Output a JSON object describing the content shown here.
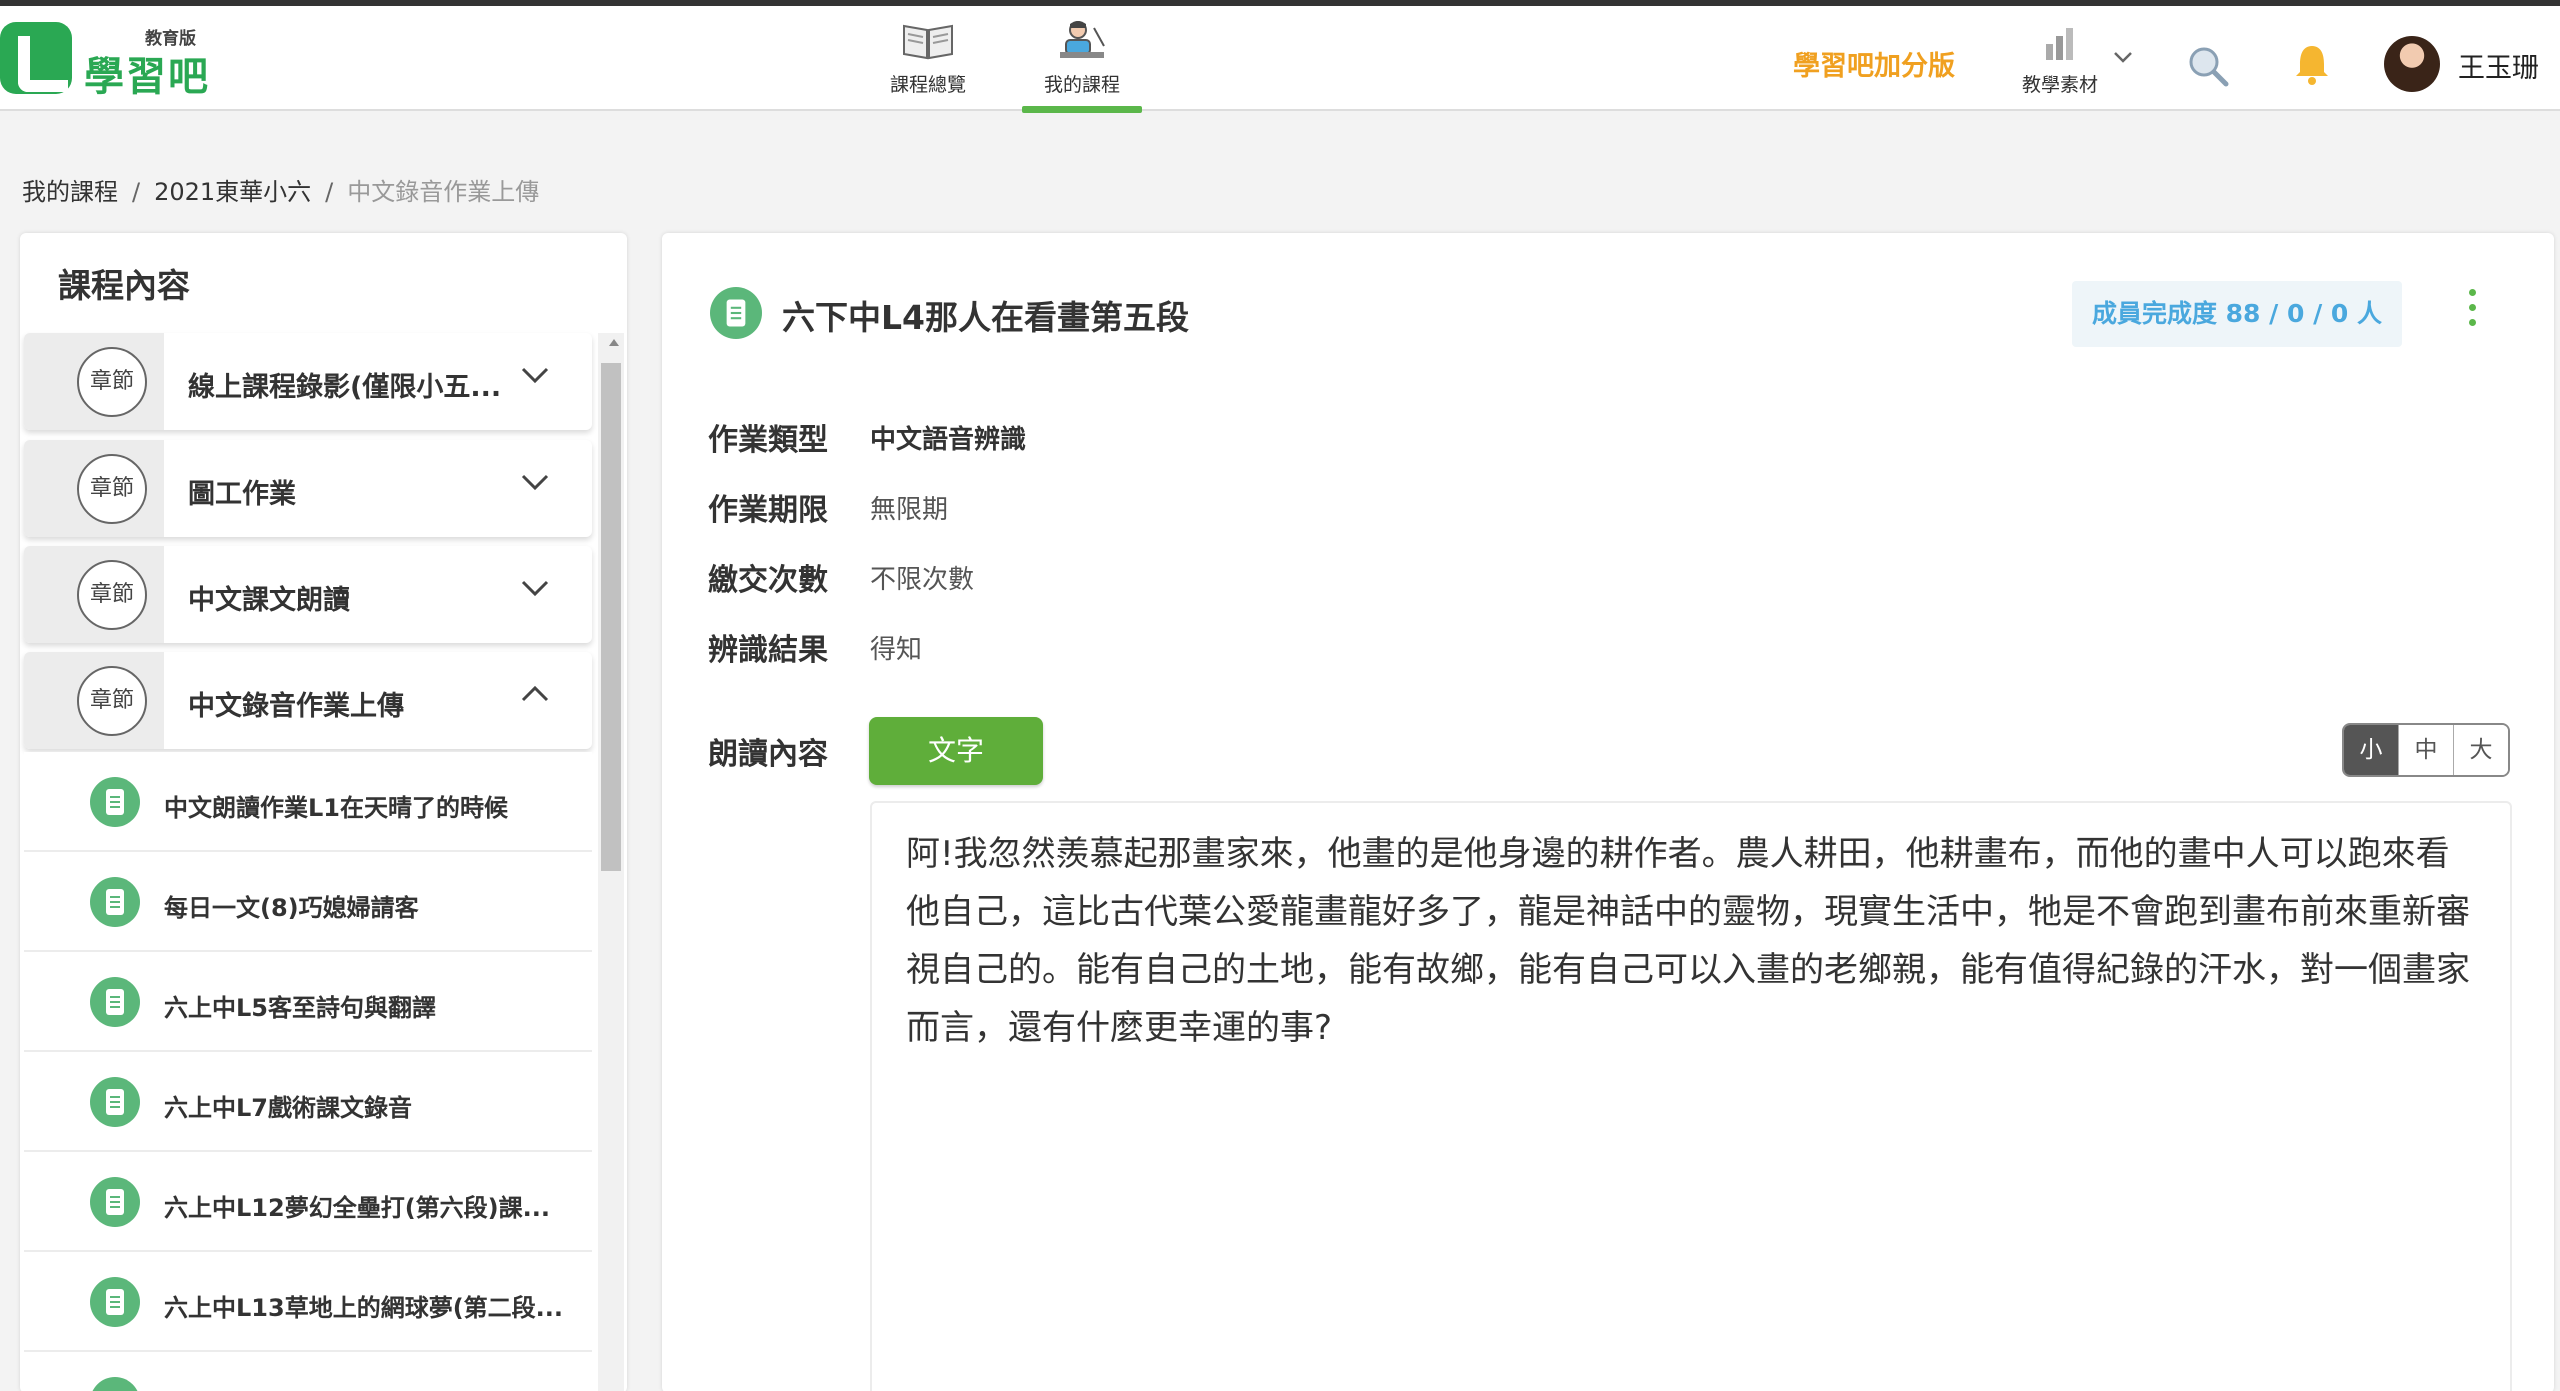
{
  "header": {
    "logo_edu": "教育版",
    "logo_text": "學習吧",
    "nav": [
      {
        "label": "課程總覽",
        "icon": "book-icon"
      },
      {
        "label": "我的課程",
        "icon": "teacher-icon",
        "active": true
      }
    ],
    "bonus_label": "學習吧加分版",
    "material_label": "教學素材",
    "user_name": "王玉珊"
  },
  "breadcrumb": [
    "我的課程",
    "2021東華小六",
    "中文錄音作業上傳"
  ],
  "breadcrumb_sep": "/",
  "sidebar": {
    "title": "課程內容",
    "chapter_badge": "章節",
    "chapters": [
      {
        "label": "線上課程錄影(僅限小五...",
        "expanded": false
      },
      {
        "label": "圖工作業",
        "expanded": false
      },
      {
        "label": "中文課文朗讀",
        "expanded": false
      },
      {
        "label": "中文錄音作業上傳",
        "expanded": true
      }
    ],
    "lessons": [
      "中文朗讀作業L1在天晴了的時候",
      "每日一文(8)巧媳婦請客",
      "六上中L5客至詩句與翻譯",
      "六上中L7戲術課文錄音",
      "六上中L12夢幻全壘打(第六段)課...",
      "六上中L13草地上的網球夢(第二段..."
    ]
  },
  "main": {
    "title": "六下中L4那人在看畫第五段",
    "completion": "成員完成度 88 / 0 / 0 人",
    "fields": [
      {
        "label": "作業類型",
        "value": "中文語音辨識",
        "strong": true
      },
      {
        "label": "作業期限",
        "value": "無限期",
        "strong": false
      },
      {
        "label": "繳交次數",
        "value": "不限次數",
        "strong": false
      },
      {
        "label": "辨識結果",
        "value": "得知",
        "strong": false
      }
    ],
    "reading_label": "朗讀內容",
    "text_button": "文字",
    "sizes": [
      {
        "label": "小",
        "active": true
      },
      {
        "label": "中",
        "active": false
      },
      {
        "label": "大",
        "active": false
      }
    ],
    "reading_text": "阿!我忽然羨慕起那畫家來，他畫的是他身邊的耕作者。農人耕田，他耕畫布，而他的畫中人可以跑來看他自己，這比古代葉公愛龍畫龍好多了，龍是神話中的靈物，現實生活中，牠是不會跑到畫布前來重新審視自己的。能有自己的土地，能有故鄉，能有自己可以入畫的老鄉親，能有值得紀錄的汗水，對一個畫家而言，還有什麼更幸運的事?"
  },
  "colors": {
    "brand_green": "#2aa853",
    "accent_green": "#5fae3a",
    "bonus_orange": "#f0a020",
    "completion_blue": "#4aa8de"
  }
}
